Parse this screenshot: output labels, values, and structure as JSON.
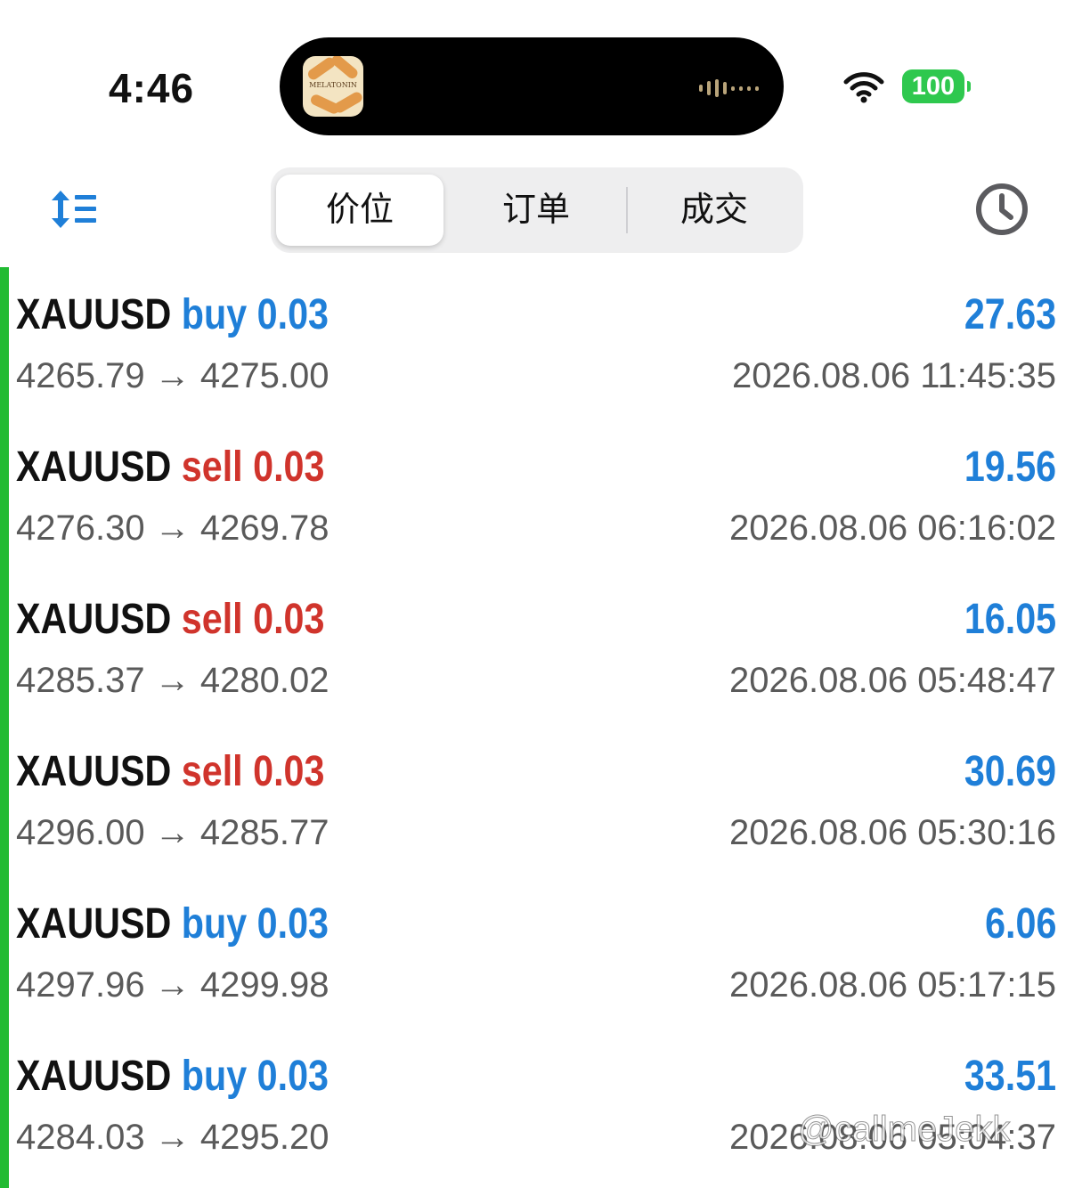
{
  "status_bar": {
    "time": "4:46",
    "battery": "100",
    "island_art_text": "MELATONIN",
    "icons": [
      "wifi-icon",
      "battery-icon",
      "waveform-icon"
    ]
  },
  "nav": {
    "sort_icon": "sort-icon",
    "history_icon": "clock-icon",
    "tabs": [
      "价位",
      "订单",
      "成交"
    ],
    "active_tab": "价位"
  },
  "colors": {
    "buy": "#1f7fd8",
    "sell": "#d0342c",
    "profit": "#1f7fd8",
    "accent_bar": "#22bb33"
  },
  "trades": [
    {
      "symbol": "XAUUSD",
      "side": "buy 0.03",
      "profit": "27.63",
      "open_price": "4265.79",
      "close_price": "4275.00",
      "arrow": "→",
      "close_time": "2026.08.06 11:45:35"
    },
    {
      "symbol": "XAUUSD",
      "side": "sell 0.03",
      "profit": "19.56",
      "open_price": "4276.30",
      "close_price": "4269.78",
      "arrow": "→",
      "close_time": "2026.08.06 06:16:02"
    },
    {
      "symbol": "XAUUSD",
      "side": "sell 0.03",
      "profit": "16.05",
      "open_price": "4285.37",
      "close_price": "4280.02",
      "arrow": "→",
      "close_time": "2026.08.06 05:48:47"
    },
    {
      "symbol": "XAUUSD",
      "side": "sell 0.03",
      "profit": "30.69",
      "open_price": "4296.00",
      "close_price": "4285.77",
      "arrow": "→",
      "close_time": "2026.08.06 05:30:16"
    },
    {
      "symbol": "XAUUSD",
      "side": "buy 0.03",
      "profit": "6.06",
      "open_price": "4297.96",
      "close_price": "4299.98",
      "arrow": "→",
      "close_time": "2026.08.06 05:17:15"
    },
    {
      "symbol": "XAUUSD",
      "side": "buy 0.03",
      "profit": "33.51",
      "open_price": "4284.03",
      "close_price": "4295.20",
      "arrow": "→",
      "close_time": "2026.08.06 05:04:37"
    }
  ],
  "watermark": "@callmeJekk"
}
